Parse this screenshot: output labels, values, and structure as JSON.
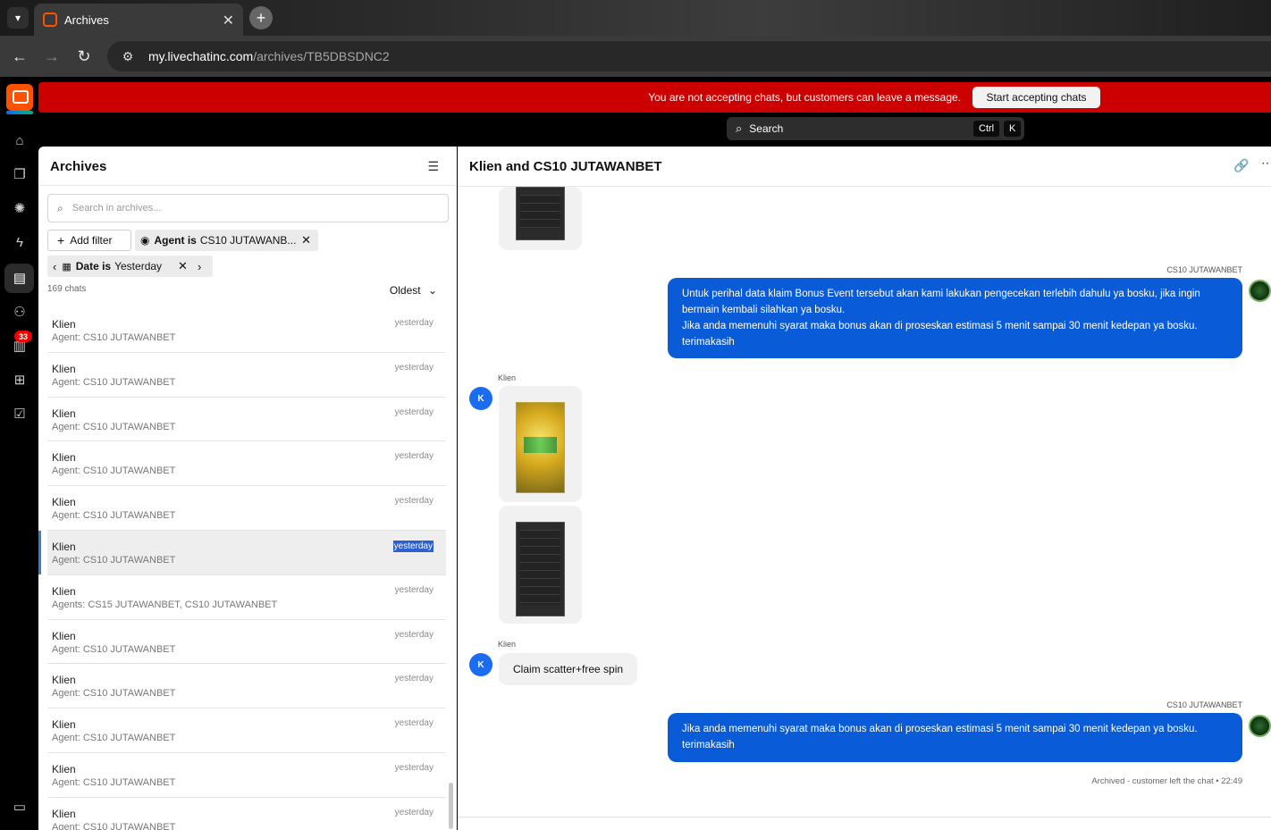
{
  "browser": {
    "tab_title": "Archives",
    "url_host": "my.livechatinc.com",
    "url_path": "/archives/TB5DBSDNC2"
  },
  "rail": {
    "badge_count": "33"
  },
  "banner": {
    "message": "You are not accepting chats, but customers can leave a message.",
    "button_label": "Start accepting chats",
    "color": "#cc0000"
  },
  "global_search": {
    "label": "Search",
    "key1": "Ctrl",
    "key2": "K"
  },
  "archives": {
    "title": "Archives",
    "search_placeholder": "Search in archives...",
    "add_filter_label": "Add filter",
    "agent_filter_key": "Agent is",
    "agent_filter_value": "CS10 JUTAWANB...",
    "date_filter_key": "Date is",
    "date_filter_value": "Yesterday",
    "count": "169 chats",
    "sort_label": "Oldest",
    "rows": [
      {
        "name": "Klien",
        "agent": "Agent: CS10 JUTAWANBET",
        "time": "yesterday"
      },
      {
        "name": "Klien",
        "agent": "Agent: CS10 JUTAWANBET",
        "time": "yesterday"
      },
      {
        "name": "Klien",
        "agent": "Agent: CS10 JUTAWANBET",
        "time": "yesterday"
      },
      {
        "name": "Klien",
        "agent": "Agent: CS10 JUTAWANBET",
        "time": "yesterday"
      },
      {
        "name": "Klien",
        "agent": "Agent: CS10 JUTAWANBET",
        "time": "yesterday"
      },
      {
        "name": "Klien",
        "agent": "Agent: CS10 JUTAWANBET",
        "time": "yesterday",
        "selected": true
      },
      {
        "name": "Klien",
        "agent": "Agents: CS15 JUTAWANBET, CS10 JUTAWANBET",
        "time": "yesterday"
      },
      {
        "name": "Klien",
        "agent": "Agent: CS10 JUTAWANBET",
        "time": "yesterday"
      },
      {
        "name": "Klien",
        "agent": "Agent: CS10 JUTAWANBET",
        "time": "yesterday"
      },
      {
        "name": "Klien",
        "agent": "Agent: CS10 JUTAWANBET",
        "time": "yesterday"
      },
      {
        "name": "Klien",
        "agent": "Agent: CS10 JUTAWANBET",
        "time": "yesterday"
      },
      {
        "name": "Klien",
        "agent": "Agent: CS10 JUTAWANBET",
        "time": "yesterday"
      }
    ]
  },
  "chat": {
    "title": "Klien and CS10 JUTAWANBET",
    "agent_name": "CS10 JUTAWANBET",
    "customer_name": "Klien",
    "customer_initial": "K",
    "agent_message_1": [
      "Untuk perihal data klaim Bonus Event tersebut akan kami lakukan pengecekan terlebih dahulu ya bosku, jika ingin bermain kembali silahkan ya bosku.",
      "Jika anda memenuhi syarat maka bonus akan di proseskan estimasi 5 menit sampai 30 menit kedepan ya bosku.",
      "terimakasih"
    ],
    "customer_message": "Claim scatter+free spin",
    "agent_message_2": [
      "Jika anda memenuhi syarat maka bonus akan di proseskan estimasi 5 menit sampai 30 menit kedepan ya bosku.",
      "terimakasih"
    ],
    "archived_note": "Archived - customer left the chat • 22:49",
    "accent_color": "#0a5bd8"
  }
}
